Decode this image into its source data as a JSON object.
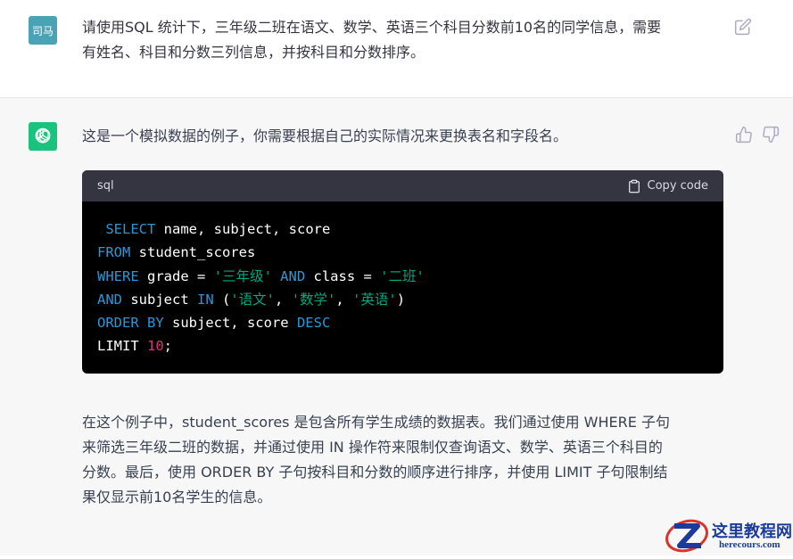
{
  "user_message": {
    "avatar_text": "司马",
    "line1": "请使用SQL 统计下，三年级二班在语文、数学、英语三个科目分数前10名的同学信息，需要",
    "line2": "有姓名、科目和分数三列信息，并按科目和分数排序。"
  },
  "assistant_message": {
    "intro": "这是一个模拟数据的例子，你需要根据自己的实际情况来更换表名和字段名。",
    "code_language": "sql",
    "copy_label": "Copy code",
    "code": {
      "l1_kw": "SELECT",
      "l1_rest": " name, subject, score",
      "l2_kw": "FROM",
      "l2_rest": " student_scores",
      "l3_kw": "WHERE",
      "l3_a": " grade = ",
      "l3_s1": "'三年级'",
      "l3_kw2": " AND",
      "l3_b": " class = ",
      "l3_s2": "'二班'",
      "l4_kw": "AND",
      "l4_a": " subject ",
      "l4_kw2": "IN",
      "l4_b": " (",
      "l4_s1": "'语文'",
      "l4_c": ", ",
      "l4_s2": "'数学'",
      "l4_d": ", ",
      "l4_s3": "'英语'",
      "l4_e": ")",
      "l5_kw": "ORDER BY",
      "l5_a": " subject, score ",
      "l5_kw2": "DESC",
      "l6_a": "LIMIT ",
      "l6_num": "10",
      "l6_b": ";"
    },
    "explanation": [
      "在这个例子中，student_scores 是包含所有学生成绩的数据表。我们通过使用 WHERE 子句",
      "来筛选三年级二班的数据，并通过使用 IN 操作符来限制仅查询语文、数学、英语三个科目的",
      "分数。最后，使用 ORDER BY 子句按科目和分数的顺序进行排序，并使用 LIMIT 子句限制结",
      "果仅显示前10名学生的信息。"
    ]
  },
  "watermark": {
    "title": "这里教程网",
    "url": "herecours.com"
  },
  "icons": [
    "edit-icon",
    "openai-logo-icon",
    "thumbs-up-icon",
    "thumbs-down-icon",
    "clipboard-icon"
  ],
  "colors": {
    "user_avatar": "#4aa3b5",
    "gpt_avatar": "#19c37d",
    "assistant_bg": "#f7f7f8",
    "code_header_bg": "#343541",
    "code_bg": "#000000",
    "keyword": "#2e95d3",
    "string": "#00a67d",
    "number": "#df3079"
  }
}
